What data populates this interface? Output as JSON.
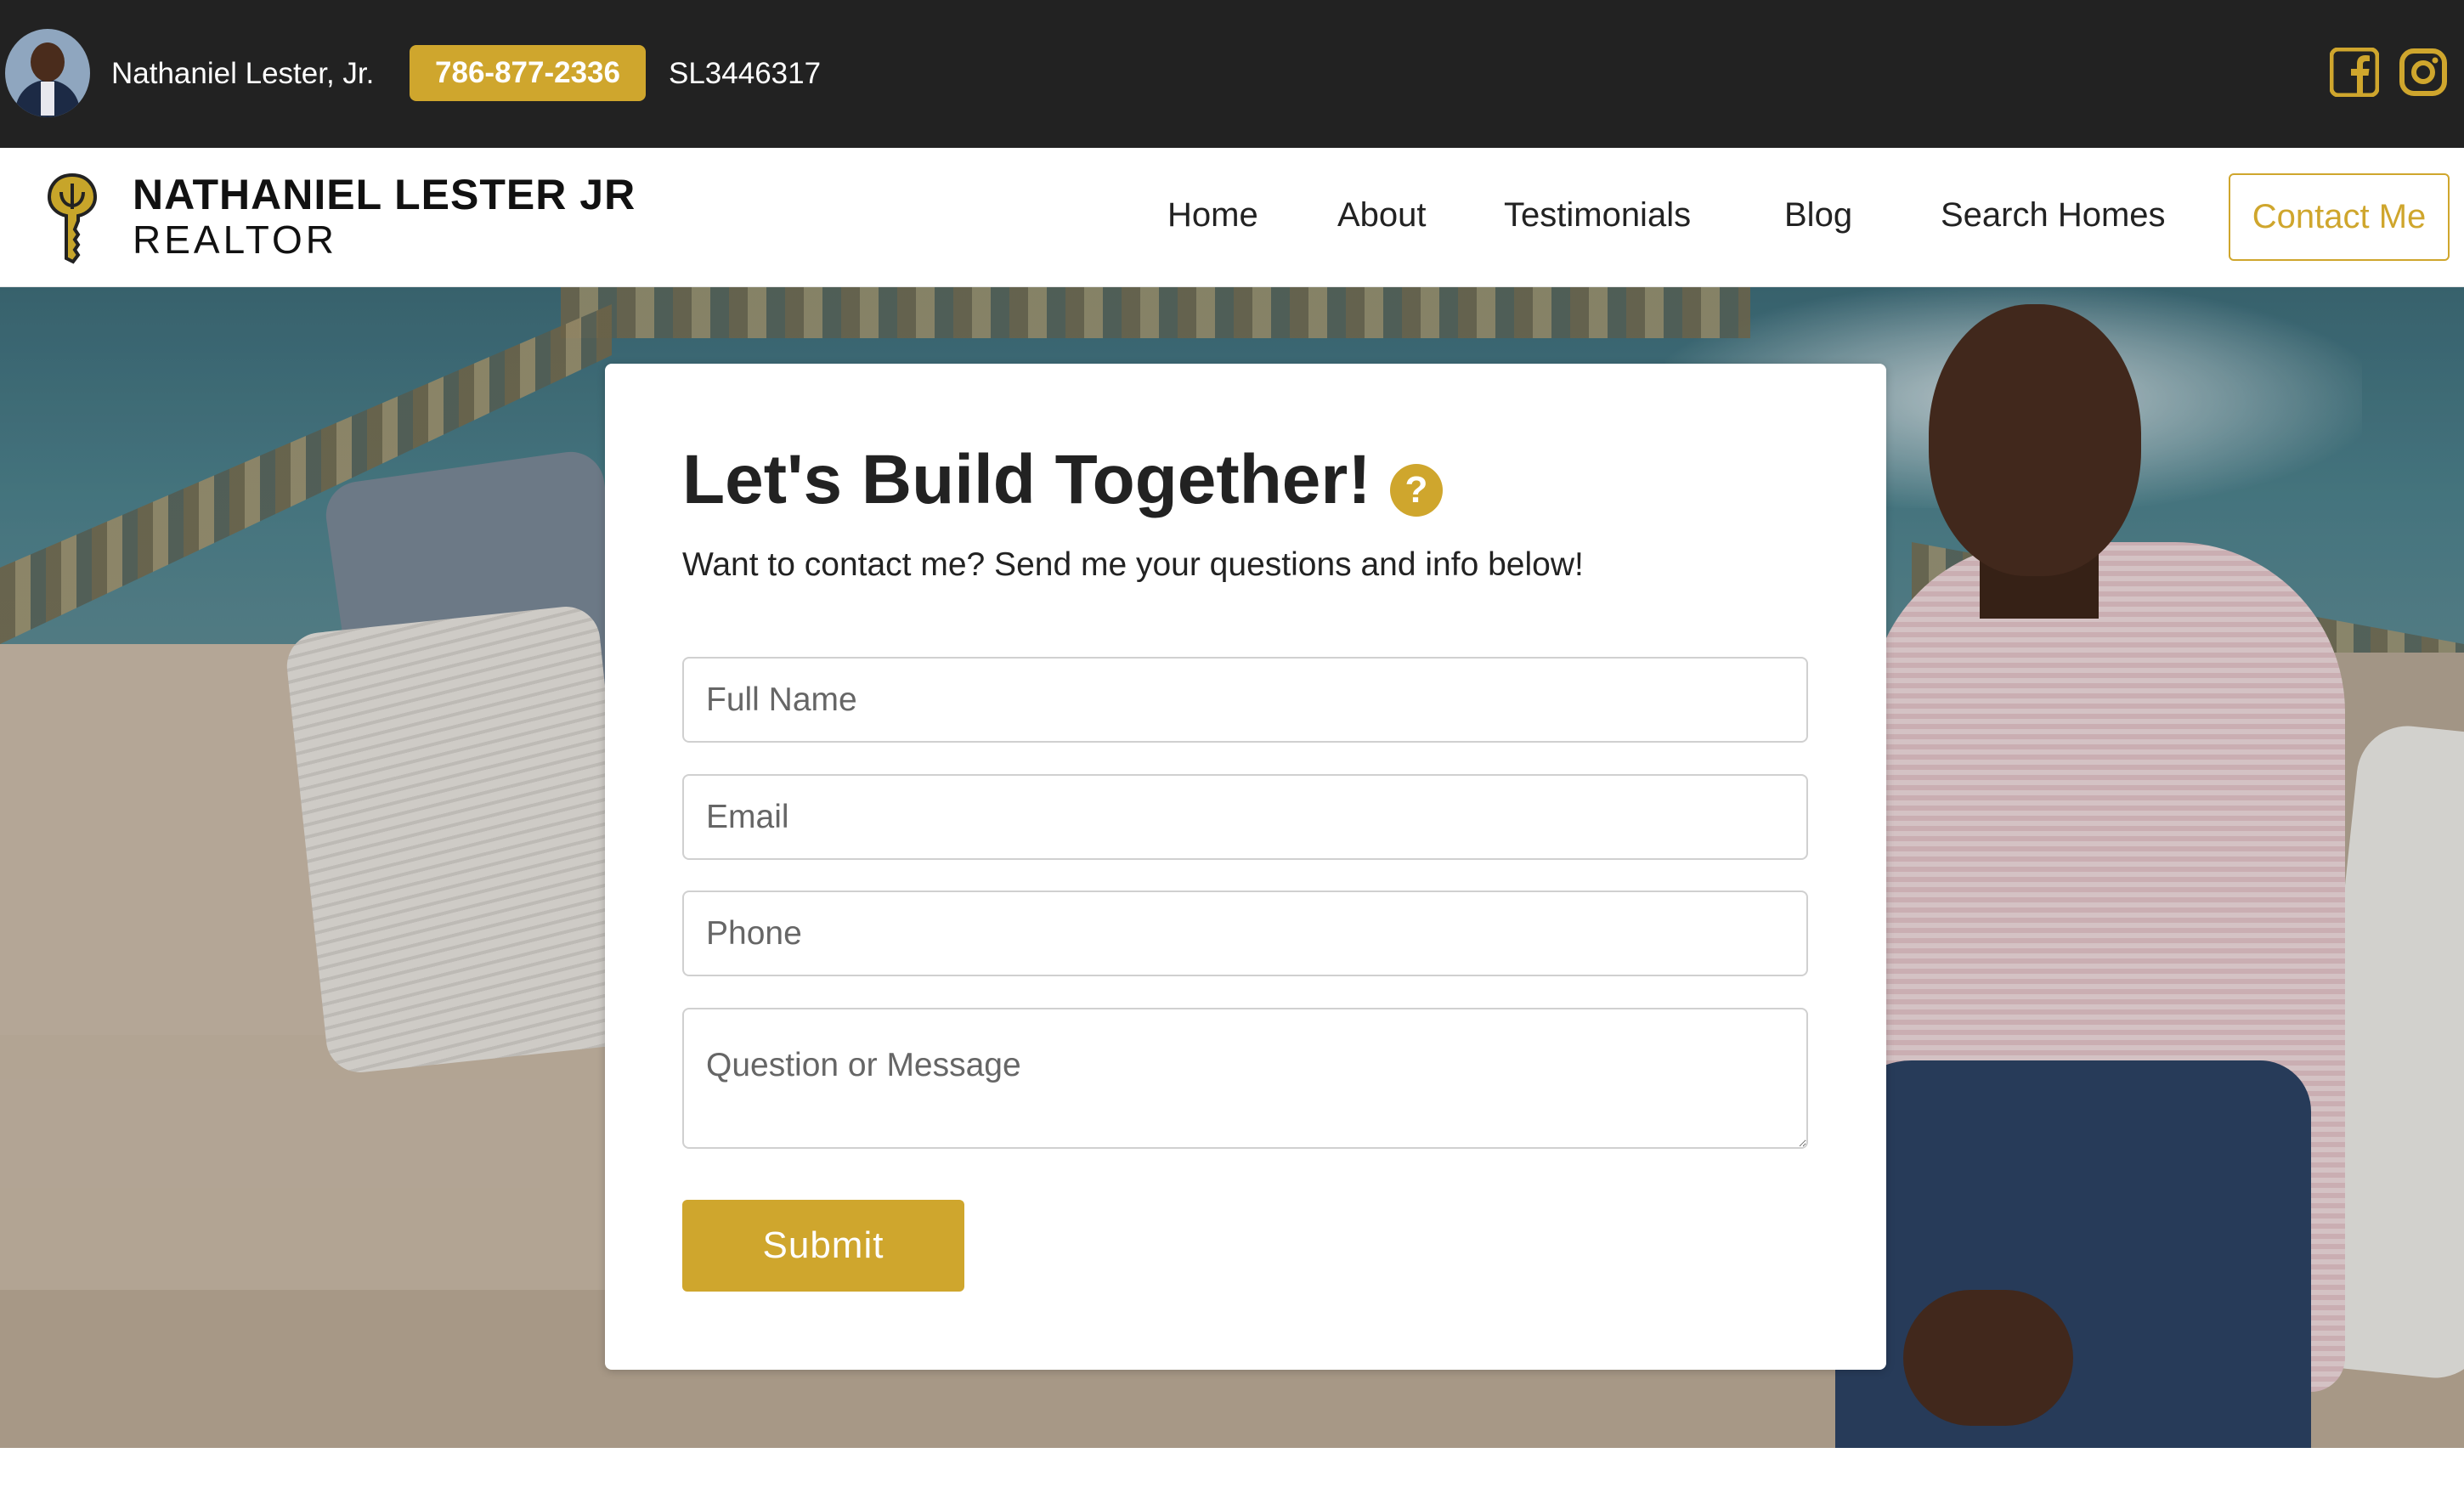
{
  "topbar": {
    "agent_name": "Nathaniel Lester, Jr.",
    "phone": "786-877-2336",
    "license": "SL3446317",
    "social_icons": [
      "facebook-icon",
      "instagram-icon"
    ]
  },
  "brand": {
    "line1": "NATHANIEL LESTER JR",
    "line2": "REALTOR",
    "logo_icon": "key-icon"
  },
  "nav": {
    "home": "Home",
    "about": "About",
    "testimonials": "Testimonials",
    "blog": "Blog",
    "search_homes": "Search Homes",
    "contact": "Contact Me"
  },
  "form": {
    "title": "Let's Build Together!",
    "help_icon_glyph": "?",
    "subtitle": "Want to contact me? Send me your questions and info below!",
    "full_name_placeholder": "Full Name",
    "email_placeholder": "Email",
    "phone_placeholder": "Phone",
    "message_placeholder": "Question or Message",
    "submit_label": "Submit"
  },
  "colors": {
    "accent": "#cfa62d",
    "topbar_bg": "#222222",
    "text": "#222222"
  }
}
